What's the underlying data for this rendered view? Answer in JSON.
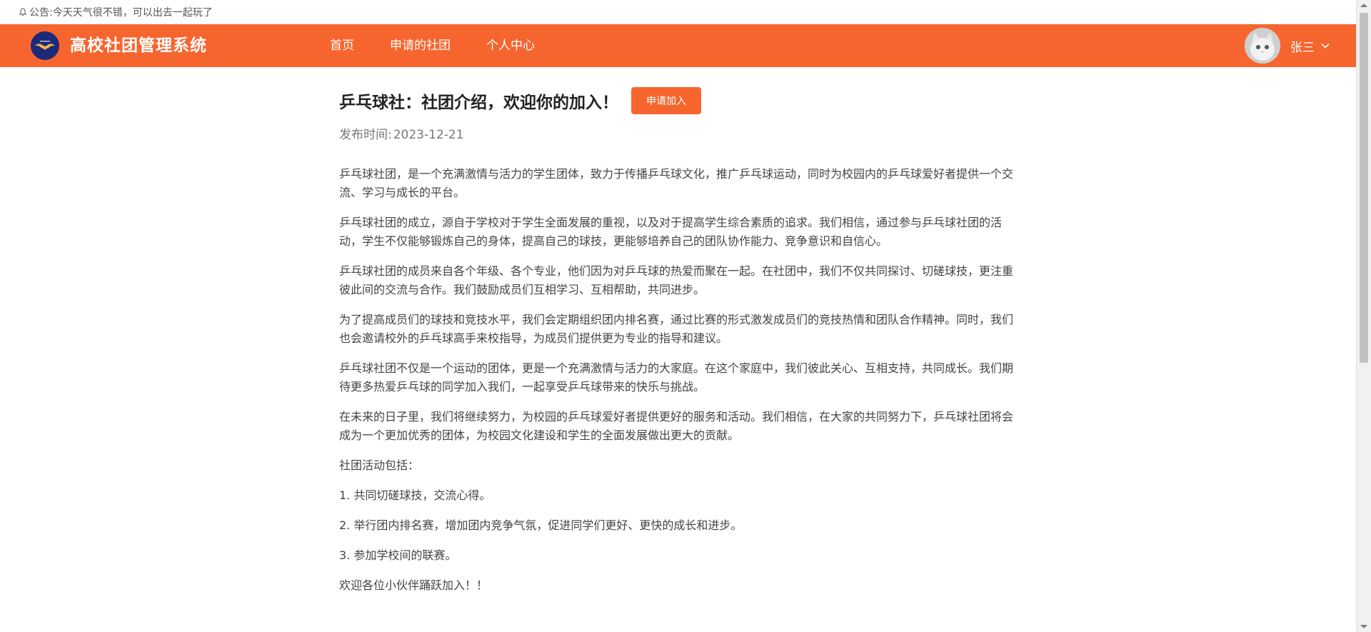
{
  "announcement": {
    "label": "公告:",
    "text": "今天天气很不错，可以出去一起玩了"
  },
  "header": {
    "app_title": "高校社团管理系统",
    "nav": [
      "首页",
      "申请的社团",
      "个人中心"
    ],
    "user_name": "张三",
    "accent_color": "#f7652f"
  },
  "article": {
    "title": "乒乓球社：社团介绍，欢迎你的加入！",
    "apply_button": "申请加入",
    "publish_label": "发布时间:",
    "publish_date": "2023-12-21",
    "paragraphs": [
      "乒乓球社团，是一个充满激情与活力的学生团体，致力于传播乒乓球文化，推广乒乓球运动，同时为校园内的乒乓球爱好者提供一个交流、学习与成长的平台。",
      "乒乓球社团的成立，源自于学校对于学生全面发展的重视，以及对于提高学生综合素质的追求。我们相信，通过参与乒乓球社团的活动，学生不仅能够锻炼自己的身体，提高自己的球技，更能够培养自己的团队协作能力、竞争意识和自信心。",
      "乒乓球社团的成员来自各个年级、各个专业，他们因为对乒乓球的热爱而聚在一起。在社团中，我们不仅共同探讨、切磋球技，更注重彼此间的交流与合作。我们鼓励成员们互相学习、互相帮助，共同进步。",
      "为了提高成员们的球技和竞技水平，我们会定期组织团内排名赛，通过比赛的形式激发成员们的竞技热情和团队合作精神。同时，我们也会邀请校外的乒乓球高手来校指导，为成员们提供更为专业的指导和建议。",
      "乒乓球社团不仅是一个运动的团体，更是一个充满激情与活力的大家庭。在这个家庭中，我们彼此关心、互相支持，共同成长。我们期待更多热爱乒乓球的同学加入我们，一起享受乒乓球带来的快乐与挑战。",
      "在未来的日子里，我们将继续努力，为校园的乒乓球爱好者提供更好的服务和活动。我们相信，在大家的共同努力下，乒乓球社团将会成为一个更加优秀的团体，为校园文化建设和学生的全面发展做出更大的贡献。",
      "社团活动包括：",
      "1. 共同切磋球技，交流心得。",
      "2. 举行团内排名赛，增加团内竞争气氛，促进同学们更好、更快的成长和进步。",
      "3. 参加学校间的联赛。",
      "欢迎各位小伙伴踊跃加入！！"
    ]
  }
}
